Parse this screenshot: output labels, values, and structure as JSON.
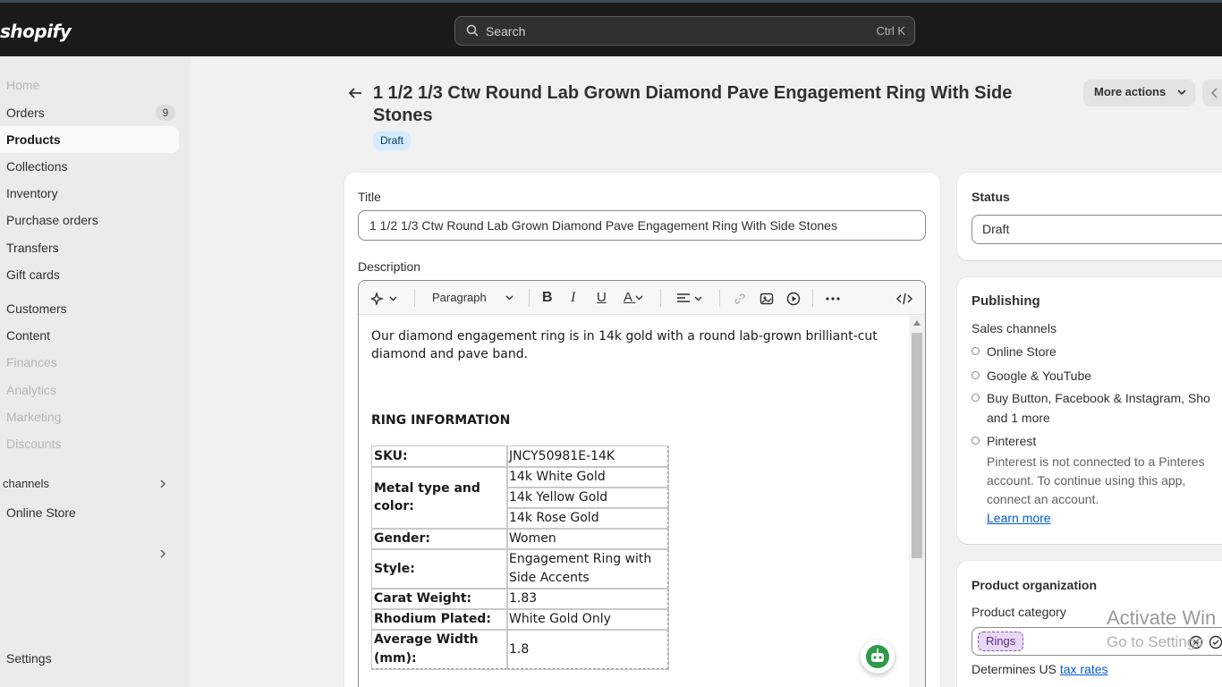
{
  "topbar": {
    "logo": "shopify",
    "search_placeholder": "Search",
    "search_shortcut": "Ctrl K"
  },
  "sidebar": {
    "home": "Home",
    "orders": "Orders",
    "orders_count": "9",
    "products": "Products",
    "collections": "Collections",
    "inventory": "Inventory",
    "purchase_orders": "Purchase orders",
    "transfers": "Transfers",
    "gift_cards": "Gift cards",
    "customers": "Customers",
    "content": "Content",
    "finances": "Finances",
    "analytics": "Analytics",
    "marketing": "Marketing",
    "discounts": "Discounts",
    "channels_header": "channels",
    "online_store": "Online Store",
    "settings": "Settings"
  },
  "header": {
    "title": "1 1/2 1/3 Ctw Round Lab Grown Diamond Pave Engagement Ring With Side Stones",
    "status": "Draft",
    "more_actions": "More actions"
  },
  "form": {
    "title_label": "Title",
    "title_value": "1 1/2 1/3 Ctw Round Lab Grown Diamond Pave Engagement Ring With Side Stones",
    "description_label": "Description",
    "paragraph_select": "Paragraph",
    "intro": "Our diamond engagement ring is in 14k gold with a round lab-grown brilliant-cut diamond and pave band.",
    "section_heading": "RING INFORMATION",
    "table": {
      "sku_k": "SKU:",
      "sku_v": "JNCY50981E-14K",
      "metal_k": "Metal type and color:",
      "metal_v1": "14k White Gold",
      "metal_v2": "14k Yellow Gold",
      "metal_v3": "14k Rose Gold",
      "gender_k": "Gender:",
      "gender_v": "Women",
      "style_k": "Style:",
      "style_v": "Engagement Ring with Side Accents",
      "carat_k": "Carat Weight:",
      "carat_v": "1.83",
      "rhodium_k": "Rhodium Plated:",
      "rhodium_v": "White Gold Only",
      "width_k": "Average Width (mm):",
      "width_v": "1.8"
    }
  },
  "status_card": {
    "label": "Status",
    "value": "Draft"
  },
  "publishing": {
    "title": "Publishing",
    "sales_channels": "Sales channels",
    "online_store": "Online Store",
    "google": "Google & YouTube",
    "buy_button": "Buy Button, Facebook & Instagram, Sho",
    "and_more": "and 1 more",
    "pinterest": "Pinterest",
    "pinterest_note_1": "Pinterest is not connected to a Pinteres",
    "pinterest_note_2": "account. To continue using this app,",
    "pinterest_note_3": "connect an account.",
    "learn_more": "Learn more"
  },
  "organization": {
    "title": "Product organization",
    "category_label": "Product category",
    "category_tag": "Rings",
    "determines_prefix": "Determines US ",
    "tax_rates": "tax rates"
  },
  "watermark": {
    "line1": "Activate Win",
    "line2": "Go to Settings"
  }
}
